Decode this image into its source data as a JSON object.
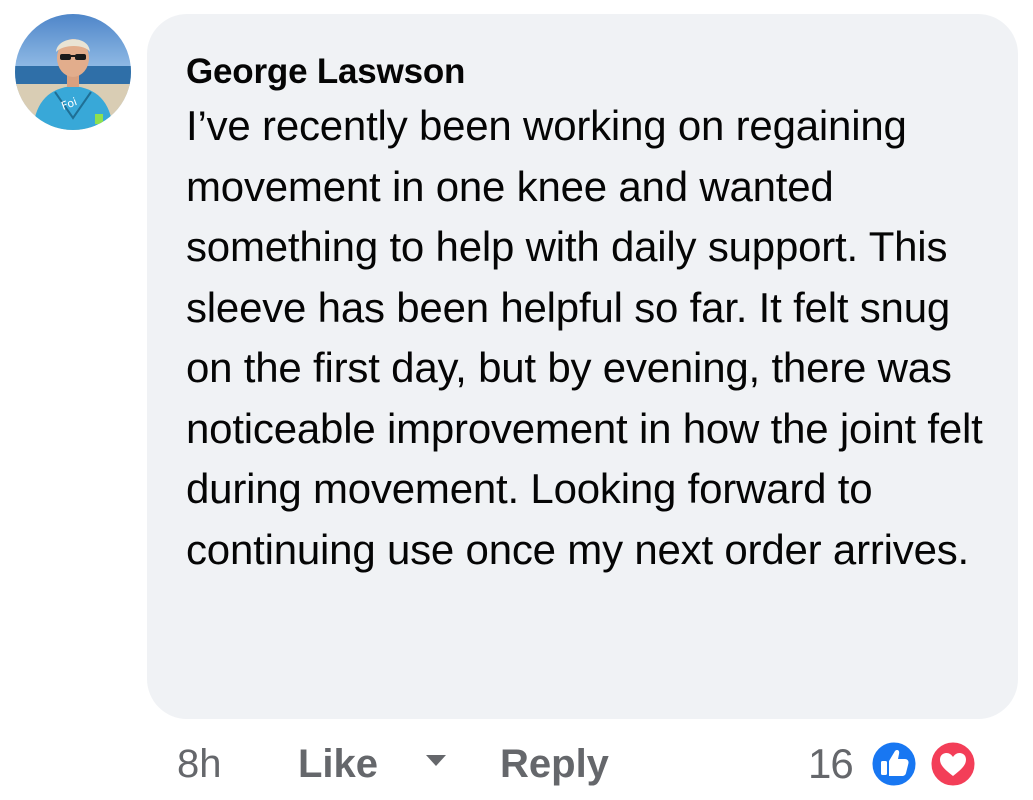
{
  "comment": {
    "author": "George Laswson",
    "text": "I’ve recently been working on regaining movement in one knee and wanted something to help with daily support. This sleeve has been helpful so far. It felt snug on the first day, but by evening, there was noticeable improvement in how the joint felt during movement. Looking forward to continuing use once my next order arrives.",
    "avatar_icon": "profile-photo"
  },
  "actions": {
    "time": "8h",
    "like_label": "Like",
    "reply_label": "Reply",
    "reaction_count": "16",
    "reactions": [
      "like-reaction-icon",
      "love-reaction-icon"
    ]
  },
  "colors": {
    "bubble_bg": "#f0f2f5",
    "text": "#050505",
    "secondary_text": "#65676b",
    "like_blue": "#1877f2",
    "love_red": "#f33e58"
  }
}
